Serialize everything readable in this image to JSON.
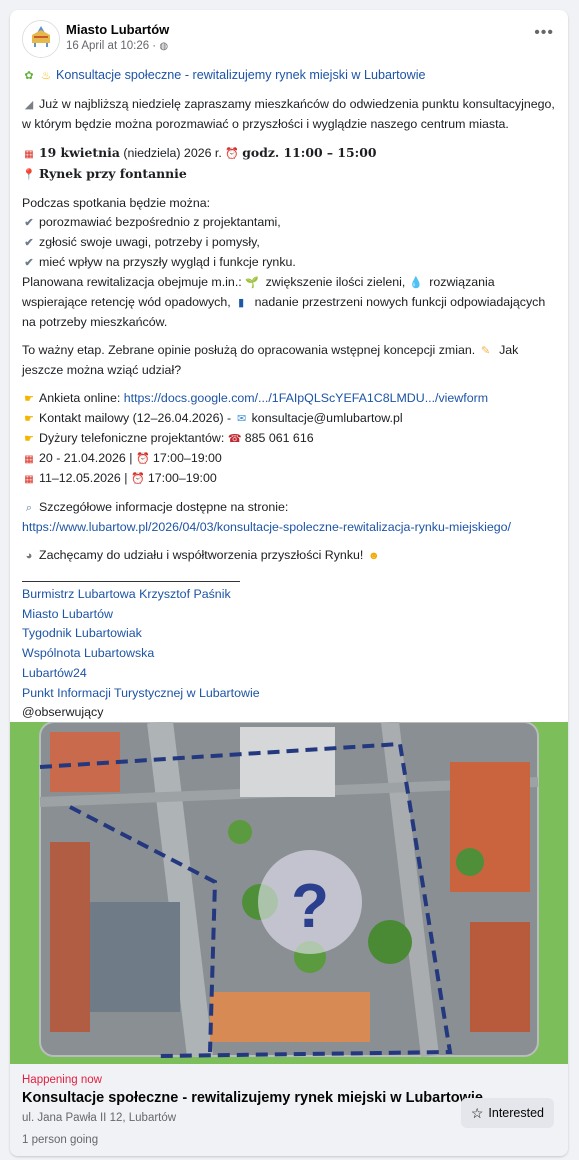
{
  "post": {
    "author": "Miasto Lubartów",
    "date": "16 April at 10:26 ·",
    "logo_text": "Lubartów",
    "more_icon": "ellipsis-icon"
  },
  "content": {
    "title": "Konsultacje społeczne - rewitalizujemy rynek miejski w Lubartowie",
    "intro": "Już w najbliższą niedzielę zapraszamy mieszkańców do odwiedzenia punktu konsultacyjnego, w którym będzie można porozmawiać o przyszłości i wyglądzie naszego centrum miasta.",
    "date_bold": "19 kwietnia",
    "date_rest": " (niedziela)  2026 r. ",
    "time_bold": "godz. 11:00 – 15:00",
    "place": "Rynek przy fontannie",
    "during": "Podczas spotkania będzie można:",
    "bullets": [
      "porozmawiać bezpośrednio z projektantami,",
      "zgłosić swoje uwagi, potrzeby i pomysły,",
      "mieć wpływ na przyszły wygląd i funkcje rynku."
    ],
    "plan_a": "Planowana rewitalizacja obejmuje m.in.: ",
    "plan_b": " zwiększenie ilości zieleni, ",
    "plan_c": " rozwiązania wspierające retencję wód opadowych, ",
    "plan_d": " nadanie przestrzeni nowych funkcji odpowiadających na potrzeby mieszkańców.",
    "stage_a": "To ważny etap. Zebrane opinie posłużą do opracowania wstępnej koncepcji zmian. ",
    "stage_b": " Jak jeszcze można wziąć udział?",
    "survey_label": "Ankieta online: ",
    "survey_link": "https://docs.google.com/.../1FAIpQLScYEFA1C8LMDU.../viewform",
    "contact_label": "Kontakt mailowy (12–26.04.2026) - ",
    "contact_email": "konsultacje@umlubartow.pl",
    "phone_label": "Dyżury telefoniczne projektantów: ",
    "phone_number": "885 061 616",
    "slot1_date": "20 - 21.04.2026 | ",
    "slot1_time": "17:00–19:00",
    "slot2_date": "11–12.05.2026 | ",
    "slot2_time": "17:00–19:00",
    "details_label": "Szczegółowe informacje dostępne na stronie:",
    "details_link": "https://www.lubartow.pl/2026/04/03/konsultacje-spoleczne-rewitalizacja-rynku-miejskiego/",
    "encourage": "Zachęcamy do udziału i współtworzenia przyszłości Rynku! ",
    "tags": [
      "Burmistrz Lubartowa Krzysztof Paśnik",
      "Miasto Lubartów",
      "Tygodnik Lubartowiak",
      "Wspólnota Lubartowska",
      "Lubartów24",
      "Punkt Informacji Turystycznej w Lubartowie"
    ],
    "followers": "@obserwujący"
  },
  "image": {
    "question_mark": "?"
  },
  "event": {
    "status": "Happening now",
    "title": "Konsultacje społeczne - rewitalizujemy rynek miejski w Lubartowie",
    "address": "ul. Jana Pawła II 12, Lubartów",
    "going": "1 person going",
    "interested_label": "Interested"
  },
  "colors": {
    "link": "#1d54a6",
    "happening": "#e41e3f",
    "button_bg": "#e4e6eb"
  }
}
